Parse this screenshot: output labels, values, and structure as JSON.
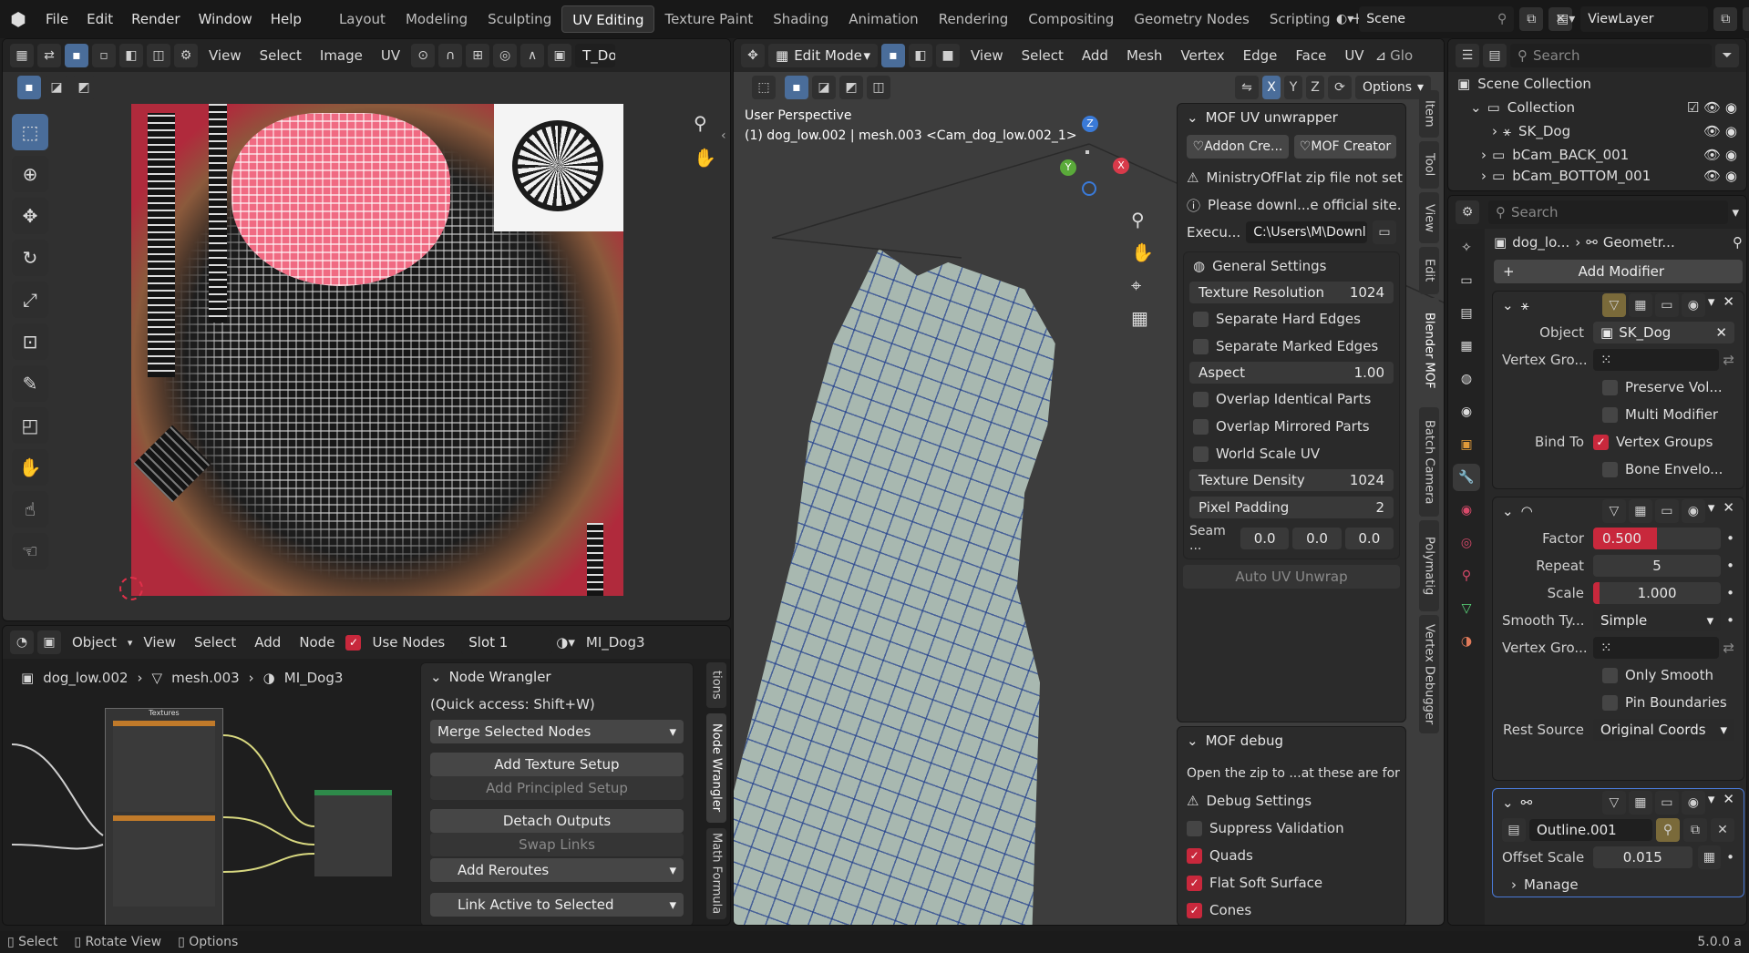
{
  "topbar": {
    "menus": [
      "File",
      "Edit",
      "Render",
      "Window",
      "Help"
    ],
    "workspaces": [
      "Layout",
      "Modeling",
      "Sculpting",
      "UV Editing",
      "Texture Paint",
      "Shading",
      "Animation",
      "Rendering",
      "Compositing",
      "Geometry Nodes",
      "Scripting"
    ],
    "active_workspace": "UV Editing",
    "scene": "Scene",
    "view_layer": "ViewLayer"
  },
  "uv_editor": {
    "menus": [
      "View",
      "Select",
      "Image",
      "UV"
    ],
    "image_name": "T_Dog"
  },
  "viewport": {
    "mode": "Edit Mode",
    "menus": [
      "View",
      "Select",
      "Add",
      "Mesh",
      "Vertex",
      "Edge",
      "Face",
      "UV"
    ],
    "glob_label": "Glo",
    "options": "Options",
    "axes": [
      "X",
      "Y",
      "Z"
    ],
    "perspective": "User Perspective",
    "object_info": "(1) dog_low.002 | mesh.003 <Cam_dog_low.002_1>",
    "tabs": [
      "Item",
      "Tool",
      "View",
      "Edit",
      "Blender MOF",
      "Batch Camera",
      "Polymatig",
      "Vertex Debugger"
    ],
    "active_tab": "Blender MOF"
  },
  "mof": {
    "title": "MOF UV unwrapper",
    "addon_credits": "Addon Cre...",
    "mof_creator": "MOF Creator",
    "warning1": "MinistryOfFlat zip file not set",
    "warning2": "Please downl...e official site.",
    "exec_label": "Execu...",
    "exec_path": "C:\\Users\\M\\Downl...",
    "general_settings": "General Settings",
    "texture_resolution_label": "Texture Resolution",
    "texture_resolution": "1024",
    "separate_hard_edges": "Separate Hard Edges",
    "separate_marked_edges": "Separate Marked Edges",
    "aspect_label": "Aspect",
    "aspect": "1.00",
    "overlap_identical": "Overlap Identical Parts",
    "overlap_mirrored": "Overlap Mirrored Parts",
    "world_scale_uv": "World Scale UV",
    "texture_density_label": "Texture Density",
    "texture_density": "1024",
    "pixel_padding_label": "Pixel Padding",
    "pixel_padding": "2",
    "seam_label": "Seam ...",
    "seam_values": [
      "0.0",
      "0.0",
      "0.0"
    ],
    "auto_unwrap": "Auto UV Unwrap"
  },
  "mof_debug": {
    "title": "MOF debug",
    "info": "Open the zip to ...at these are for",
    "debug_settings": "Debug Settings",
    "suppress_validation": "Suppress Validation",
    "quads": "Quads",
    "flat_soft_surface": "Flat Soft Surface",
    "cones": "Cones"
  },
  "outliner": {
    "search": "Search",
    "scene_collection": "Scene Collection",
    "items": [
      "Collection",
      "SK_Dog",
      "bCam_BACK_001",
      "bCam_BOTTOM_001"
    ]
  },
  "properties": {
    "search": "Search",
    "breadcrumb_object": "dog_lo...",
    "breadcrumb_mod": "Geometr...",
    "add_modifier": "Add Modifier",
    "armature": {
      "object_label": "Object",
      "object_value": "SK_Dog",
      "vgroup_label": "Vertex Gro...",
      "preserve_volume": "Preserve Vol...",
      "multi_modifier": "Multi Modifier",
      "bind_to_label": "Bind To",
      "vertex_groups": "Vertex Groups",
      "bone_envelopes": "Bone Envelo..."
    },
    "smooth": {
      "factor_label": "Factor",
      "factor": "0.500",
      "factor_fill": 0.5,
      "repeat_label": "Repeat",
      "repeat": "5",
      "scale_label": "Scale",
      "scale": "1.000",
      "scale_fill": 0.05,
      "smooth_type_label": "Smooth Ty...",
      "smooth_type": "Simple",
      "vgroup_label": "Vertex Gro...",
      "only_smooth": "Only Smooth",
      "pin_boundaries": "Pin Boundaries",
      "rest_source_label": "Rest Source",
      "rest_source": "Original Coords"
    },
    "geonodes": {
      "node_group": "Outline.001",
      "offset_scale_label": "Offset Scale",
      "offset_scale": "0.015",
      "manage": "Manage"
    }
  },
  "node_editor": {
    "type": "Object",
    "menus": [
      "View",
      "Select",
      "Add",
      "Node"
    ],
    "use_nodes": "Use Nodes",
    "slot": "Slot 1",
    "material": "MI_Dog3",
    "breadcrumb": [
      "dog_low.002",
      "mesh.003",
      "MI_Dog3"
    ],
    "frame_label": "Textures",
    "tabs": [
      "tions",
      "Node Wrangler",
      "Math Formula"
    ],
    "active_tab": "Node Wrangler"
  },
  "node_wrangler": {
    "title": "Node Wrangler",
    "quick": "(Quick access: Shift+W)",
    "merge": "Merge Selected Nodes",
    "add_texture_setup": "Add Texture Setup",
    "add_principled_setup": "Add Principled Setup",
    "detach_outputs": "Detach Outputs",
    "swap_links": "Swap Links",
    "add_reroutes": "Add Reroutes",
    "link_active": "Link Active to Selected"
  },
  "statusbar": {
    "items": [
      "Select",
      "Rotate View",
      "Options"
    ],
    "version": "5.0.0 a"
  },
  "colors": {
    "accent": "#4a6d9a",
    "red": "#c8283c",
    "bg": "#1d1d1d",
    "panel": "#2b2b2b"
  }
}
